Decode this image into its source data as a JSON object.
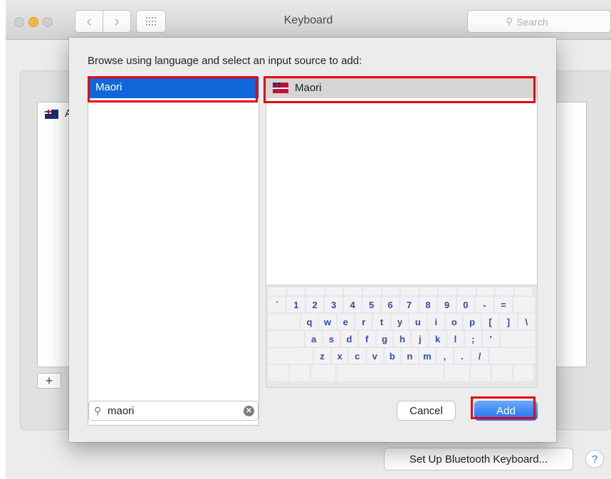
{
  "window": {
    "title": "Keyboard",
    "search_placeholder": "Search"
  },
  "background": {
    "input_source_fragment": "A",
    "add_symbol": "+",
    "bluetooth_button": "Set Up Bluetooth Keyboard...",
    "help_button": "?"
  },
  "sheet": {
    "prompt": "Browse using language and select an input source to add:",
    "languages": [
      {
        "label": "Maori",
        "selected": true
      }
    ],
    "sources": [
      {
        "label": "Maori",
        "flag": "maori-flag",
        "selected": true
      }
    ],
    "search_value": "maori",
    "cancel_label": "Cancel",
    "add_label": "Add"
  },
  "keyboard": {
    "rows": [
      [
        "`",
        "1",
        "2",
        "3",
        "4",
        "5",
        "6",
        "7",
        "8",
        "9",
        "0",
        "-",
        "="
      ],
      [
        "q",
        "w",
        "e",
        "r",
        "t",
        "y",
        "u",
        "i",
        "o",
        "p",
        "[",
        "]",
        "\\"
      ],
      [
        "a",
        "s",
        "d",
        "f",
        "g",
        "h",
        "j",
        "k",
        "l",
        ";",
        "'"
      ],
      [
        "z",
        "x",
        "c",
        "v",
        "b",
        "n",
        "m",
        ",",
        ".",
        "/"
      ]
    ]
  },
  "colors": {
    "selection_blue": "#1067d9",
    "highlight_red": "#e8000b",
    "key_text_blue": "#2f4fa8"
  }
}
